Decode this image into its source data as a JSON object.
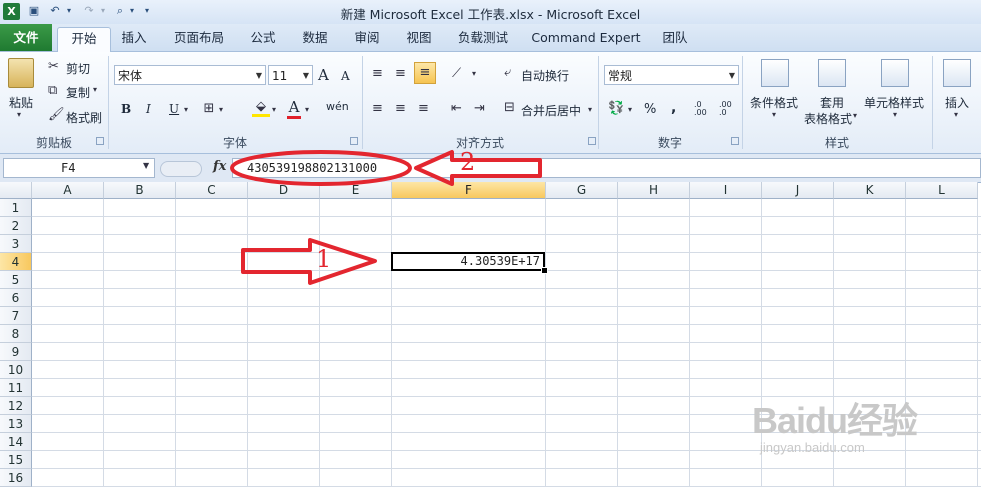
{
  "window": {
    "title": "新建 Microsoft Excel 工作表.xlsx - Microsoft Excel"
  },
  "tabs": [
    {
      "label": "文件"
    },
    {
      "label": "开始"
    },
    {
      "label": "插入"
    },
    {
      "label": "页面布局"
    },
    {
      "label": "公式"
    },
    {
      "label": "数据"
    },
    {
      "label": "审阅"
    },
    {
      "label": "视图"
    },
    {
      "label": "负载测试"
    },
    {
      "label": "Command Expert"
    },
    {
      "label": "团队"
    }
  ],
  "ribbon": {
    "clipboard": {
      "paste": "粘贴",
      "cut": "剪切",
      "copy": "复制",
      "format_painter": "格式刷",
      "label": "剪贴板"
    },
    "font": {
      "name": "宋体",
      "size": "11",
      "bold": "B",
      "italic": "I",
      "underline": "U",
      "label": "字体",
      "grow": "A",
      "shrink": "A",
      "color_a": "A",
      "wen": "wén"
    },
    "alignment": {
      "wrap": "自动换行",
      "merge": "合并后居中",
      "label": "对齐方式"
    },
    "number": {
      "format": "常规",
      "percent": "%",
      "comma": ",",
      "label": "数字",
      "inc_decimal": ".0 .00",
      "dec_decimal": ".00 .0"
    },
    "styles": {
      "conditional": "条件格式",
      "table": "套用",
      "table2": "表格格式",
      "cell_styles": "单元格样式",
      "label": "样式"
    },
    "cells": {
      "insert": "插入"
    }
  },
  "formula_bar": {
    "name_box": "F4",
    "fx": "fx",
    "value": "430539198802131000"
  },
  "sheet": {
    "columns": [
      "A",
      "B",
      "C",
      "D",
      "E",
      "F",
      "G",
      "H",
      "I",
      "J",
      "K",
      "L"
    ],
    "rows": [
      "1",
      "2",
      "3",
      "4",
      "5",
      "6",
      "7",
      "8",
      "9",
      "10",
      "11",
      "12",
      "13",
      "14",
      "15",
      "16"
    ],
    "selected_cell": {
      "ref": "F4",
      "display": "4.30539E+17"
    }
  },
  "annotations": {
    "arrow1": "1",
    "arrow2": "2"
  },
  "watermark": {
    "brand": "Baidu经验",
    "url": "jingyan.baidu.com"
  },
  "colors": {
    "file_tab": "#1f7a31",
    "annotation_red": "#e3262f",
    "selected_header": "#f8c85e"
  }
}
